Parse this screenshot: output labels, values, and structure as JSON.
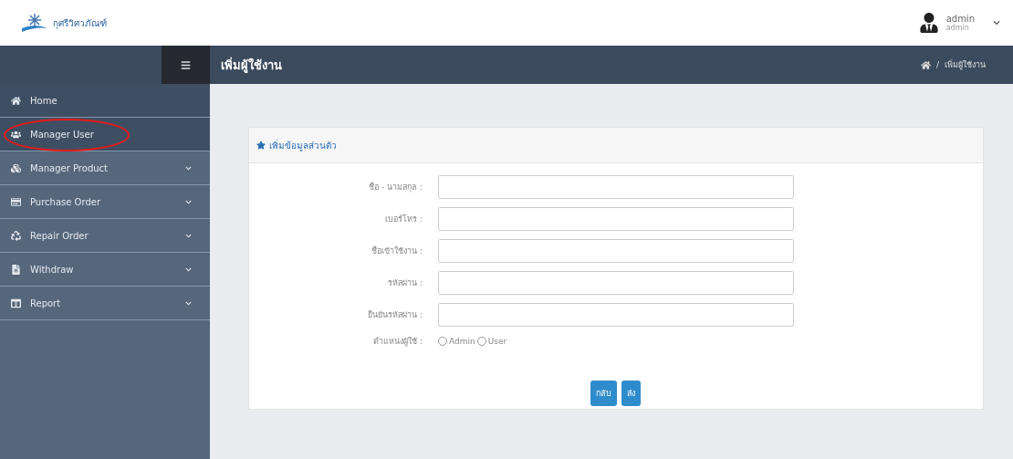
{
  "header": {
    "logo_text": "กุศรีวิศวภัณฑ์",
    "user": {
      "name": "admin",
      "role": "admin"
    }
  },
  "navbar": {
    "title": "เพิ่มผู้ใช้งาน",
    "separator": "/",
    "breadcrumb": "เพิ่มผู้ใช้งาน"
  },
  "sidebar": {
    "items": [
      {
        "label": "Home",
        "expandable": false,
        "highlighted": false
      },
      {
        "label": "Manager User",
        "expandable": false,
        "highlighted": true
      },
      {
        "label": "Manager Product",
        "expandable": true,
        "highlighted": false
      },
      {
        "label": "Purchase Order",
        "expandable": true,
        "highlighted": false
      },
      {
        "label": "Repair Order",
        "expandable": true,
        "highlighted": false
      },
      {
        "label": "Withdraw",
        "expandable": true,
        "highlighted": false
      },
      {
        "label": "Report",
        "expandable": true,
        "highlighted": false
      }
    ]
  },
  "form": {
    "title": "เพิ่มข้อมูลส่วนตัว",
    "fields": [
      {
        "label": "ชื่อ - นามสกุล :"
      },
      {
        "label": "เบอร์โทร :"
      },
      {
        "label": "ชื่อเข้าใช้งาน :"
      },
      {
        "label": "รหัสผ่าน :"
      },
      {
        "label": "ยืนยันรหัสผ่าน :"
      }
    ],
    "role": {
      "label": "ตำแหน่งผู้ใช้ :",
      "options": [
        {
          "label": "Admin",
          "selected": false
        },
        {
          "label": "User",
          "selected": false
        }
      ]
    },
    "buttons": [
      "กลับ",
      "ส่ง"
    ]
  }
}
